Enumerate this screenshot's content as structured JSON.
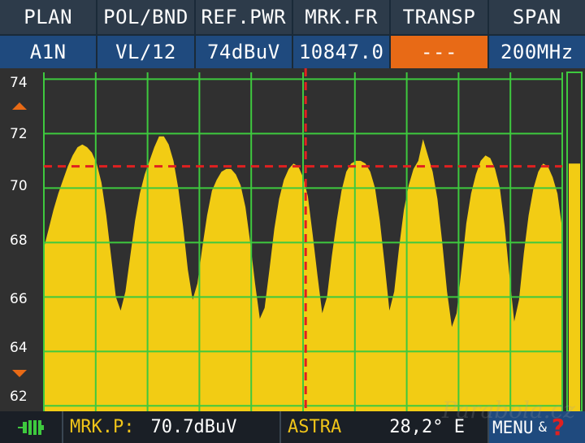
{
  "header": {
    "labels": [
      "PLAN",
      "POL/BND",
      "REF.PWR",
      "MRK.FR",
      "TRANSP",
      "SPAN"
    ],
    "values": [
      "A1N",
      "VL/12",
      "74dBuV",
      "10847.0",
      "---",
      "200MHz"
    ]
  },
  "chart_data": {
    "type": "area",
    "y_ticks": [
      "74",
      "72",
      "70",
      "68",
      "66",
      "64",
      "62"
    ],
    "ylim": [
      62,
      74
    ],
    "marker_level_dbuv": 70.8,
    "marker_position_fraction": 0.505,
    "level_bar_dbuv": 70.9,
    "grid": true,
    "spectrum_dbuv": [
      67.8,
      68.5,
      69.2,
      69.8,
      70.3,
      70.8,
      71.2,
      71.5,
      71.6,
      71.5,
      71.3,
      70.9,
      70.2,
      69.0,
      67.5,
      66.0,
      65.5,
      66.2,
      67.5,
      68.8,
      69.8,
      70.5,
      71.0,
      71.5,
      71.9,
      71.9,
      71.6,
      71.0,
      70.0,
      68.6,
      67.0,
      65.9,
      66.5,
      67.8,
      69.0,
      69.9,
      70.3,
      70.6,
      70.7,
      70.7,
      70.5,
      70.1,
      69.3,
      68.0,
      66.5,
      65.2,
      65.6,
      67.0,
      68.5,
      69.6,
      70.3,
      70.7,
      70.9,
      70.8,
      70.4,
      69.7,
      68.3,
      66.8,
      65.4,
      66.0,
      67.5,
      68.8,
      69.9,
      70.6,
      70.9,
      71.0,
      71.0,
      70.9,
      70.6,
      70.0,
      68.8,
      67.2,
      65.5,
      66.2,
      67.8,
      69.2,
      70.1,
      70.7,
      71.0,
      71.8,
      71.2,
      70.6,
      69.6,
      68.0,
      66.2,
      64.9,
      65.4,
      67.0,
      68.7,
      69.8,
      70.5,
      71.0,
      71.2,
      71.1,
      70.7,
      70.0,
      68.6,
      66.8,
      65.1,
      65.9,
      67.6,
      69.0,
      70.0,
      70.6,
      70.9,
      70.8,
      70.4,
      69.8,
      68.5
    ]
  },
  "footer": {
    "marker_label": "MRK.P:",
    "marker_value": "70.7dBuV",
    "satellite": "ASTRA",
    "position": "28,2° E",
    "menu_label": "MENU",
    "amp": "&",
    "help": "?",
    "watermark": "Parabola.cz"
  },
  "colors": {
    "spectrum": "#f2cc14",
    "grid": "#3ec93e",
    "marker": "#e02020",
    "accent": "#e86a16",
    "header_value_bg": "#1f4a7e"
  }
}
